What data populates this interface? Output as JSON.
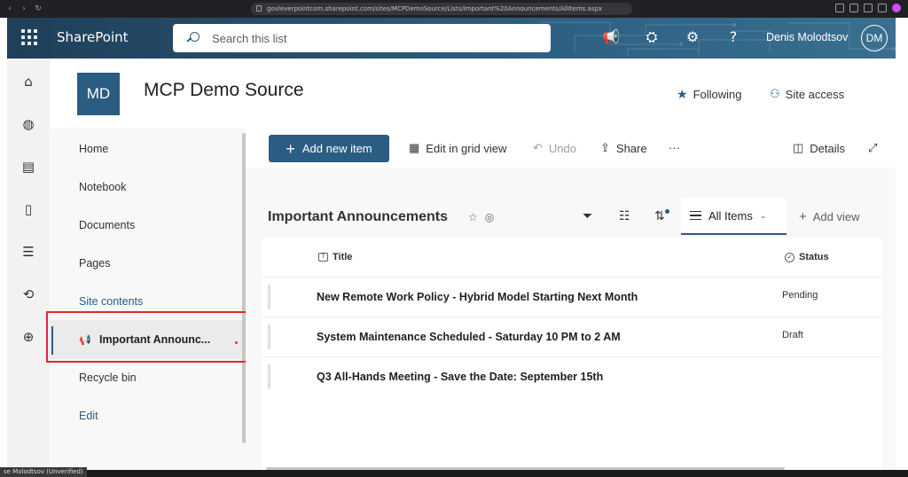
{
  "browser": {
    "url": "govleverpointcom.sharepoint.com/sites/MCPDemoSource/Lists/Important%20Announcements/AllItems.aspx"
  },
  "suite": {
    "brand": "SharePoint",
    "search_placeholder": "Search this list",
    "user_name": "Denis Molodtsov",
    "user_initials": "DM"
  },
  "site": {
    "logo_initials": "MD",
    "title": "MCP Demo Source",
    "following_label": "Following",
    "site_access_label": "Site access",
    "accent_color": "#2b5c82"
  },
  "nav": {
    "items": [
      {
        "label": "Home"
      },
      {
        "label": "Notebook"
      },
      {
        "label": "Documents"
      },
      {
        "label": "Pages"
      },
      {
        "label": "Site contents"
      },
      {
        "label": "Important Announc..."
      },
      {
        "label": "Recycle bin"
      },
      {
        "label": "Edit"
      }
    ]
  },
  "commands": {
    "add_new_item": "Add new item",
    "edit_grid": "Edit in grid view",
    "undo": "Undo",
    "share": "Share",
    "more": "···",
    "details": "Details"
  },
  "list": {
    "title": "Important Announcements",
    "view_label": "All Items",
    "add_view_label": "Add view",
    "columns": {
      "title": "Title",
      "status": "Status"
    },
    "rows": [
      {
        "title": "New Remote Work Policy - Hybrid Model Starting Next Month",
        "status": "Pending"
      },
      {
        "title": "System Maintenance Scheduled - Saturday 10 PM to 2 AM",
        "status": "Draft"
      },
      {
        "title": "Q3 All-Hands Meeting - Save the Date: September 15th",
        "status": ""
      }
    ]
  },
  "taskbar": {
    "user_label": "se Molodtsov (Unverified)"
  }
}
